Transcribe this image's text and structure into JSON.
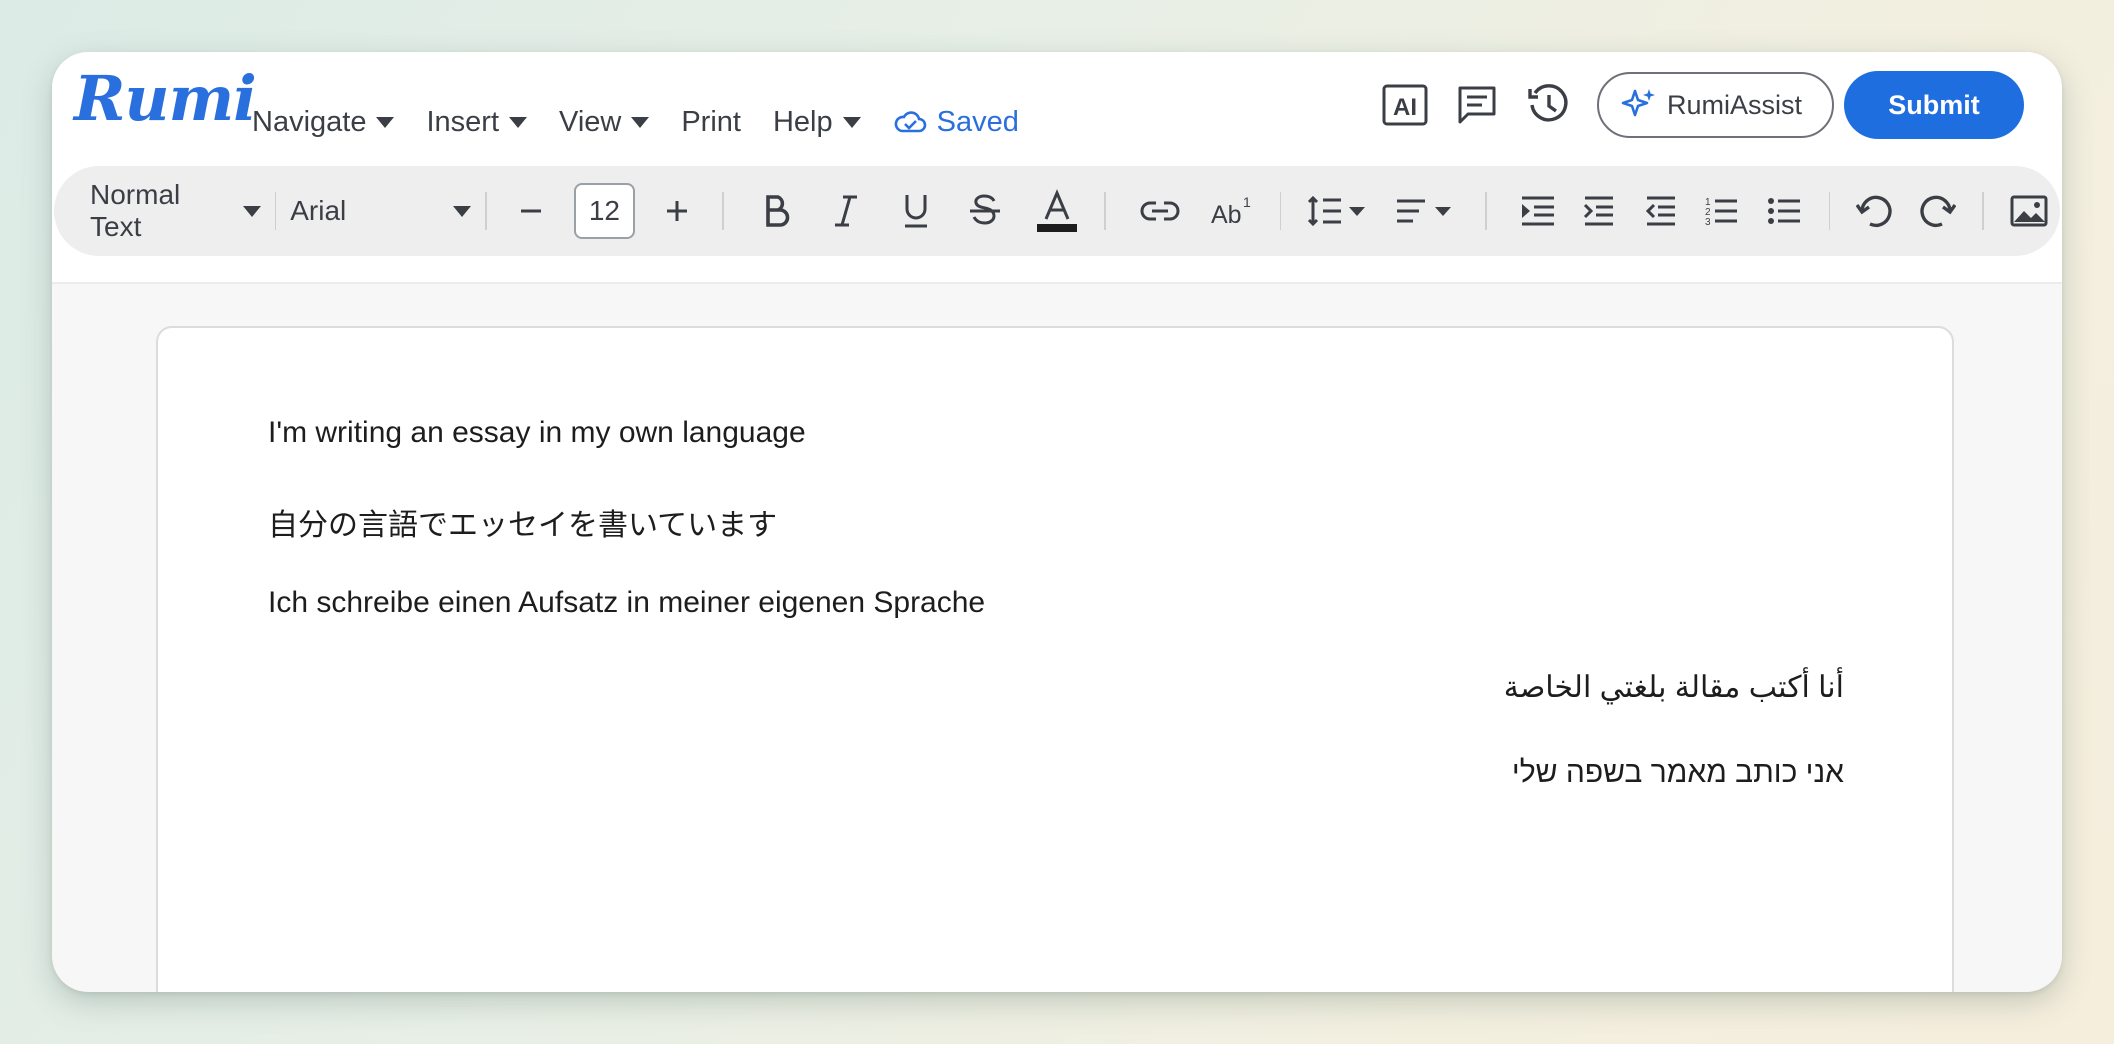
{
  "app": {
    "logo": "Rumi"
  },
  "menu": {
    "items": [
      {
        "label": "Navigate",
        "has_caret": true
      },
      {
        "label": "Insert",
        "has_caret": true
      },
      {
        "label": "View",
        "has_caret": true
      },
      {
        "label": "Print",
        "has_caret": false
      },
      {
        "label": "Help",
        "has_caret": true
      }
    ],
    "status": "Saved"
  },
  "right_tools": {
    "ai_icon_text": "AI",
    "assist_label": "RumiAssist",
    "submit_label": "Submit"
  },
  "toolbar": {
    "style_value": "Normal Text",
    "font_value": "Arial",
    "font_size": "12",
    "text_color": "#1d1d1d"
  },
  "document": {
    "lines": [
      {
        "text": "I'm writing an essay in my own language",
        "dir": "ltr"
      },
      {
        "text": "自分の言語でエッセイを書いています",
        "dir": "ltr"
      },
      {
        "text": "Ich schreibe einen Aufsatz in meiner eigenen Sprache",
        "dir": "ltr"
      },
      {
        "text": "أنا أكتب مقالة بلغتي الخاصة",
        "dir": "rtl"
      },
      {
        "text": "אני כותב מאמר בשפה שלי",
        "dir": "rtl"
      }
    ]
  },
  "colors": {
    "brand": "#2a6fde",
    "submit": "#1f6ee0"
  }
}
